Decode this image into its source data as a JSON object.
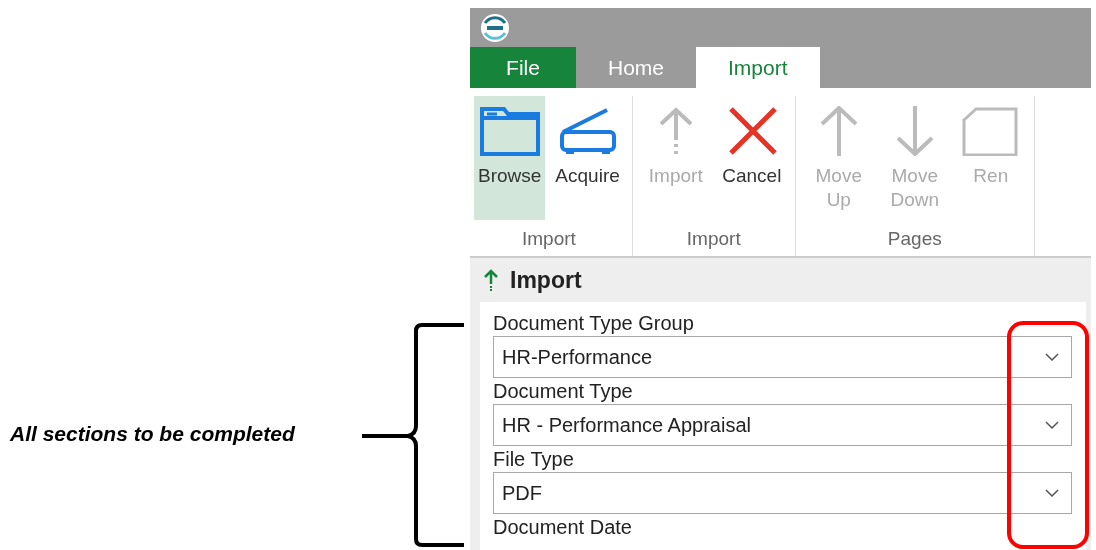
{
  "annotation": {
    "text": "All sections to be completed"
  },
  "app": {
    "tabs": [
      {
        "label": "File",
        "kind": "backstage",
        "selected": false
      },
      {
        "label": "Home",
        "kind": "tab",
        "selected": false
      },
      {
        "label": "Import",
        "kind": "tab",
        "selected": true
      }
    ],
    "ribbon": {
      "groups": [
        {
          "label": "Import",
          "buttons": [
            {
              "label": "Browse",
              "kind": "folder",
              "selected": true,
              "disabled": false
            },
            {
              "label": "Acquire",
              "kind": "scanner",
              "selected": false,
              "disabled": false
            }
          ]
        },
        {
          "label": "Import",
          "buttons": [
            {
              "label": "Import",
              "kind": "import",
              "selected": false,
              "disabled": true
            },
            {
              "label": "Cancel",
              "kind": "cancel",
              "selected": false,
              "disabled": false
            }
          ]
        },
        {
          "label": "Pages",
          "buttons": [
            {
              "label": "Move Up",
              "kind": "up",
              "selected": false,
              "disabled": true
            },
            {
              "label": "Move Down",
              "kind": "down",
              "selected": false,
              "disabled": true
            },
            {
              "label": "Ren",
              "kind": "page",
              "selected": false,
              "disabled": true
            }
          ]
        }
      ]
    },
    "panel": {
      "title": "Import",
      "fields": [
        {
          "label": "Document Type Group",
          "value": "HR-Performance"
        },
        {
          "label": "Document Type",
          "value": "HR - Performance Appraisal"
        },
        {
          "label": "File Type",
          "value": "PDF"
        },
        {
          "label": "Document Date"
        }
      ]
    }
  }
}
